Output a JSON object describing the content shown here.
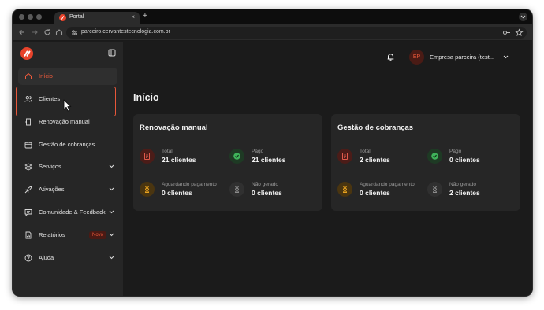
{
  "browser": {
    "tab_title": "Portal",
    "tab_close": "×",
    "new_tab": "+",
    "url": "parceiro.cervantestecnologia.com.br"
  },
  "sidebar": {
    "items": [
      {
        "label": "Início",
        "icon": "home-icon",
        "active": true
      },
      {
        "label": "Clientes",
        "icon": "users-icon"
      },
      {
        "label": "Renovação manual",
        "icon": "renew-icon"
      },
      {
        "label": "Gestão de cobranças",
        "icon": "billing-icon"
      },
      {
        "label": "Serviços",
        "icon": "services-icon",
        "expandable": true
      },
      {
        "label": "Ativações",
        "icon": "rocket-icon",
        "expandable": true
      },
      {
        "label": "Comunidade & Feedback",
        "icon": "chat-icon",
        "expandable": true
      },
      {
        "label": "Relatórios",
        "icon": "reports-icon",
        "expandable": true,
        "badge": "Novo"
      },
      {
        "label": "Ajuda",
        "icon": "help-icon",
        "expandable": true
      }
    ]
  },
  "header": {
    "avatar_initials": "EP",
    "user_name": "Empresa parceira (test..."
  },
  "main": {
    "title": "Início",
    "cards": [
      {
        "title": "Renovação manual",
        "stats": [
          {
            "label": "Total",
            "value": "21 clientes",
            "icon": "document-icon"
          },
          {
            "label": "Pago",
            "value": "21 clientes",
            "icon": "check-icon"
          },
          {
            "label": "Aguardando pagamento",
            "value": "0 clientes",
            "icon": "hourglass-icon"
          },
          {
            "label": "Não gerado",
            "value": "0 clientes",
            "icon": "hourglass-off-icon"
          }
        ]
      },
      {
        "title": "Gestão de cobranças",
        "stats": [
          {
            "label": "Total",
            "value": "2 clientes",
            "icon": "document-icon"
          },
          {
            "label": "Pago",
            "value": "0 clientes",
            "icon": "check-icon"
          },
          {
            "label": "Aguardando pagamento",
            "value": "0 clientes",
            "icon": "hourglass-icon"
          },
          {
            "label": "Não gerado",
            "value": "2 clientes",
            "icon": "hourglass-off-icon"
          }
        ]
      }
    ]
  },
  "colors": {
    "accent": "#e8432b",
    "background": "#1b1b1b",
    "sidebar": "#262626",
    "card": "#262626"
  }
}
